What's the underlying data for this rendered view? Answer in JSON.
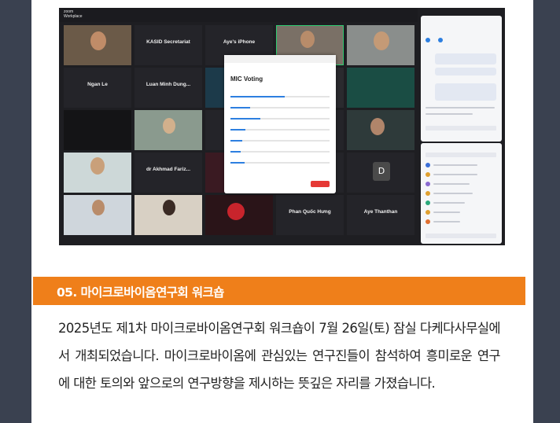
{
  "section": {
    "title": "05. 마이크로바이옴연구회 워크숍",
    "body": "2025년도 제1차 마이크로바이옴연구회 워크숍이 7월 26일(토) 잠실 다케다사무실에서 개최되었습니다. 마이크로바이옴에 관심있는 연구진들이 참석하여 흥미로운 연구에 대한 토의와 앞으로의 연구방향을 제시하는 뜻깊은 자리를 가졌습니다."
  },
  "screenshot": {
    "app_name": "zoom\nWorkplace",
    "tiles": [
      {
        "name": "KASID Secretariat"
      },
      {
        "name": "Aye's iPhone"
      },
      {
        "name": "Ngan Le"
      },
      {
        "name": "Luan Minh Dung..."
      },
      {
        "name": "dr Akhmad Fariz..."
      },
      {
        "name": "Phan Quốc Hưng"
      },
      {
        "name": "Aye Thanthan"
      }
    ],
    "avatar_letter": "D",
    "poll_title": "MIC Voting"
  }
}
